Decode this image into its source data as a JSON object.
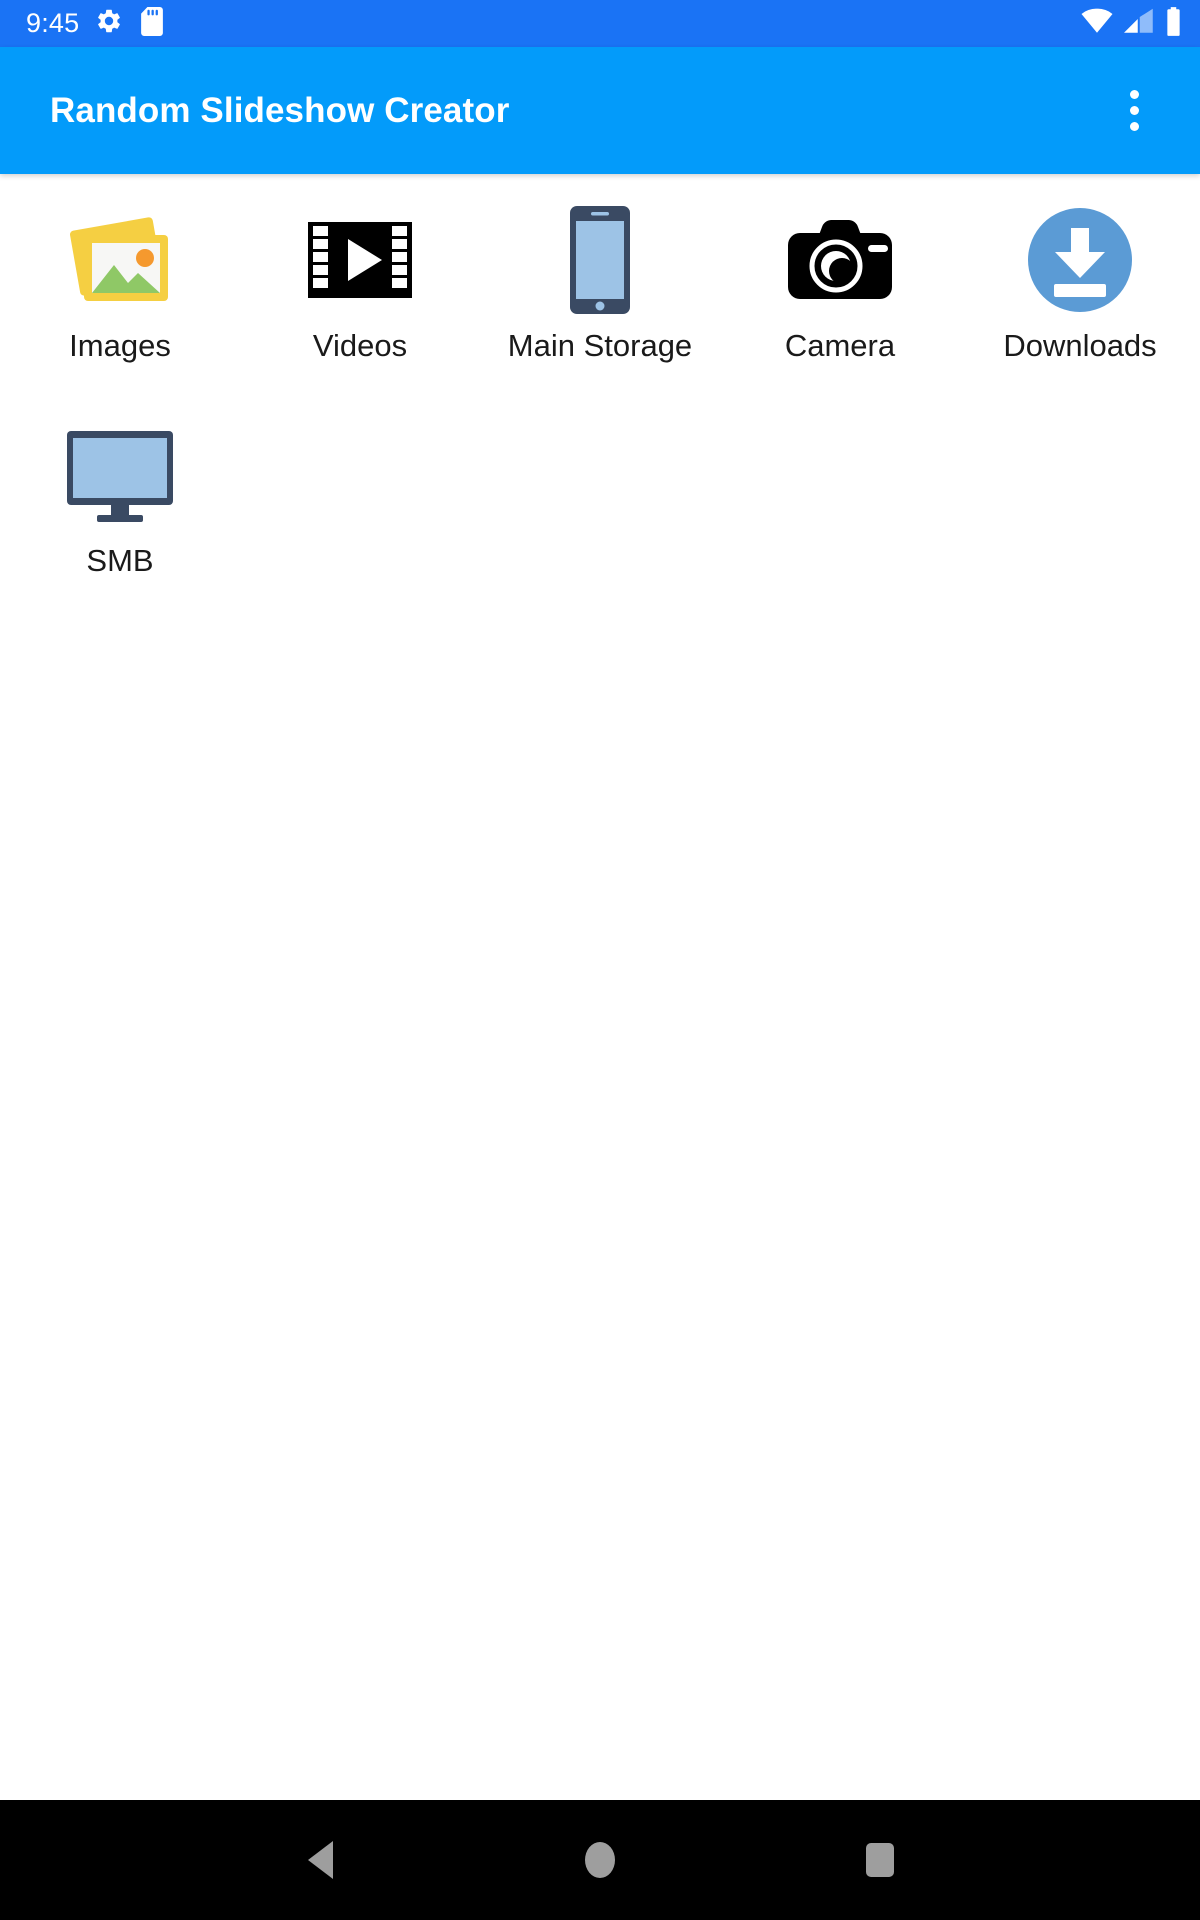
{
  "status_bar": {
    "clock": "9:45",
    "icons": [
      {
        "name": "settings-gear-icon",
        "label": "Settings"
      },
      {
        "name": "sd-card-icon",
        "label": "SD Card"
      }
    ],
    "right_icons": [
      {
        "name": "wifi-icon",
        "label": "Wi-Fi"
      },
      {
        "name": "cellular-signal-icon",
        "label": "Cellular Signal"
      },
      {
        "name": "battery-icon",
        "label": "Battery"
      }
    ],
    "background_color": "#1a73f5",
    "foreground_color": "#ffffff"
  },
  "app_bar": {
    "title": "Random Slideshow Creator",
    "overflow_menu_label": "More options",
    "background_color": "#039bfa",
    "title_color": "#ffffff"
  },
  "shortcuts": [
    {
      "label": "Images",
      "icon": "images-stack-icon"
    },
    {
      "label": "Videos",
      "icon": "film-strip-play-icon"
    },
    {
      "label": "Main Storage",
      "icon": "phone-device-icon"
    },
    {
      "label": "Camera",
      "icon": "camera-icon"
    },
    {
      "label": "Downloads",
      "icon": "download-circle-icon"
    },
    {
      "label": "SMB",
      "icon": "monitor-desktop-icon"
    }
  ],
  "nav_bar": {
    "background_color": "#000000",
    "buttons": [
      {
        "name": "back-button",
        "icon": "back-triangle-icon"
      },
      {
        "name": "home-button",
        "icon": "home-circle-icon"
      },
      {
        "name": "recents-button",
        "icon": "recents-square-icon"
      }
    ]
  },
  "theme": {
    "accent": "#039bfa",
    "status_bar": "#1a73f5",
    "content_background": "#ffffff",
    "label_color": "#1a1a1a",
    "icon_blue": "#5b9bd5",
    "icon_navy": "#3a4a63",
    "icon_screen_blue": "#9dc3e6",
    "icon_yellow": "#f5cf42",
    "icon_green": "#8fc866",
    "icon_orange": "#f5992e",
    "nav_icon_gray": "#9e9e9e"
  }
}
